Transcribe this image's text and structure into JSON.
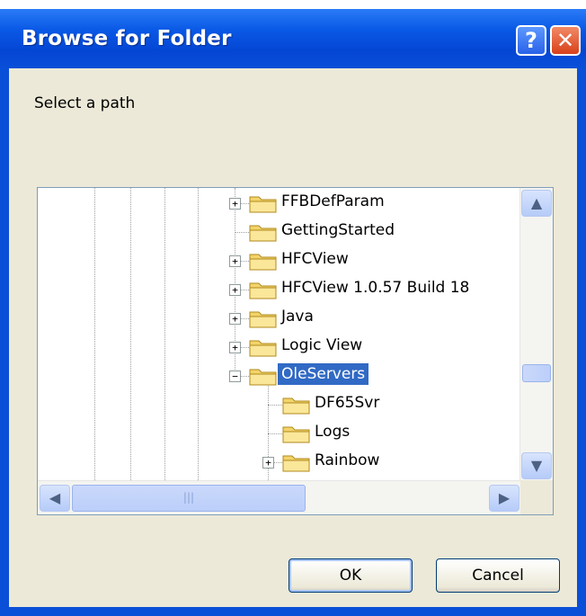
{
  "window": {
    "title": "Browse for Folder",
    "help_label": "?",
    "close_label": "✕"
  },
  "prompt": "Select a path",
  "tree": {
    "items": [
      {
        "label": "FFBDefParam",
        "expander": "+"
      },
      {
        "label": "GettingStarted",
        "expander": ""
      },
      {
        "label": "HFCView",
        "expander": "+"
      },
      {
        "label": "HFCView 1.0.57 Build 18",
        "expander": "+"
      },
      {
        "label": "Java",
        "expander": "+"
      },
      {
        "label": "Logic View",
        "expander": "+"
      },
      {
        "label": "OleServers",
        "expander": "−",
        "selected": true
      },
      {
        "label": "DF65Svr",
        "expander": ""
      },
      {
        "label": "Logs",
        "expander": ""
      },
      {
        "label": "Rainbow",
        "expander": "+"
      }
    ]
  },
  "scrollbar": {
    "up": "▲",
    "down": "▼",
    "left": "◀",
    "right": "▶",
    "grip": "|||"
  },
  "buttons": {
    "ok": "OK",
    "cancel": "Cancel"
  },
  "colors": {
    "titlebar": "#0a59e6",
    "selection": "#316ac5",
    "face": "#ece9d8"
  }
}
